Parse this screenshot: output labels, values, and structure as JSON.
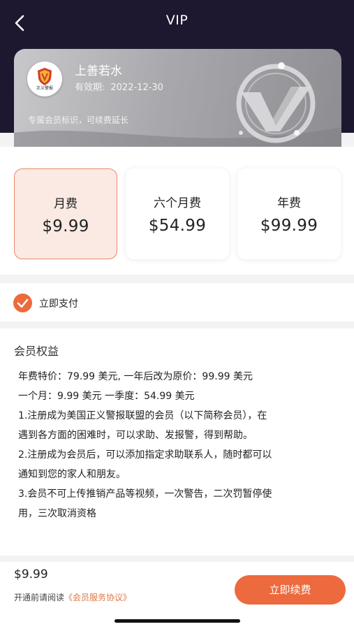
{
  "header": {
    "title": "VIP",
    "back_icon": "chevron-left-icon"
  },
  "member_card": {
    "logo_text": "正义警报",
    "username": "上善若水",
    "validity_label": "有效期:",
    "validity_date": "2022-12-30",
    "description": "专属会员标识，可续费延长"
  },
  "plans": [
    {
      "name": "月费",
      "price": "$9.99",
      "selected": true
    },
    {
      "name": "六个月费",
      "price": "$54.99",
      "selected": false
    },
    {
      "name": "年费",
      "price": "$99.99",
      "selected": false
    }
  ],
  "payment": {
    "label": "立即支付",
    "checked": true
  },
  "benefits": {
    "title": "会员权益",
    "lines": [
      "年费特价：79.99 美元, 一年后改为原价：99.99 美元",
      "一个月：9.99 美元 一季度：54.99 美元",
      "1.注册成为美国正义警报联盟的会员（以下简称会员），在",
      "遇到各方面的困难时，可以求助、发报警，得到帮助。",
      "2.注册成为会员后，可以添加指定求助联系人，随时都可以",
      "通知到您的家人和朋友。",
      "3.会员不可上传推销产品等视频，一次警告，二次罚暂停使",
      "用，三次取消资格"
    ]
  },
  "bottom_bar": {
    "price": "$9.99",
    "agreement_prefix": "开通前请阅读",
    "agreement_link": "《会员服务协议》",
    "renew_button": "立即续费"
  },
  "colors": {
    "accent": "#ec6a3e",
    "header_bg": "#1d1830",
    "selected_bg": "#fbe9e3"
  }
}
